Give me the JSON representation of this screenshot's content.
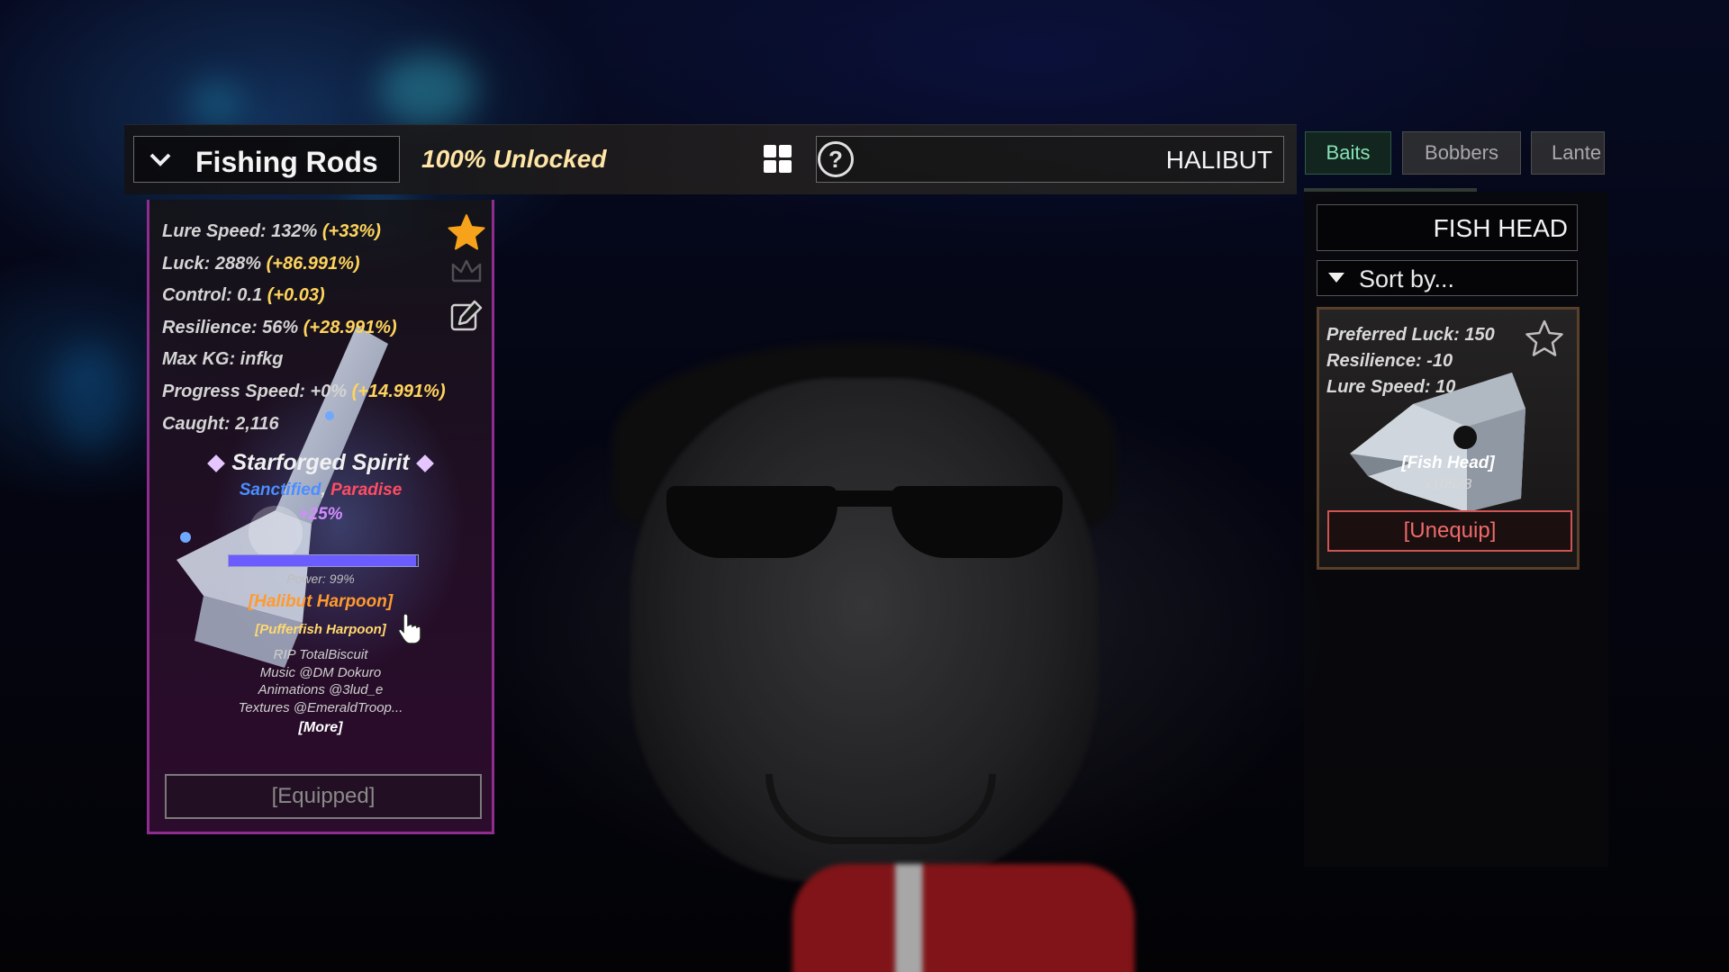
{
  "header": {
    "category": "Fishing Rods",
    "unlocked": "100% Unlocked",
    "search_value": "HALIBUT"
  },
  "tabs": [
    {
      "label": "Baits",
      "active": true
    },
    {
      "label": "Bobbers",
      "active": false
    },
    {
      "label": "Lante",
      "active": false
    }
  ],
  "rod": {
    "stats": [
      {
        "label": "Lure Speed: 132%",
        "bonus": "(+33%)"
      },
      {
        "label": "Luck: 288%",
        "bonus": "(+86.991%)"
      },
      {
        "label": "Control: 0.1",
        "bonus": "(+0.03)"
      },
      {
        "label": "Resilience: 56%",
        "bonus": "(+28.991%)"
      },
      {
        "label": "Max KG: infkg",
        "bonus": ""
      },
      {
        "label": "Progress Speed: +0%",
        "bonus": "(+14.991%)"
      },
      {
        "label": "Caught: 2,116",
        "bonus": ""
      }
    ],
    "enchant": "Starforged Spirit",
    "mutation_a": "Sanctified",
    "mutation_sep": ",",
    "mutation_b": "Paradise",
    "boost": "+25%",
    "power_label": "Power: 99%",
    "power_value": 0.99,
    "name": "[Halibut Harpoon]",
    "alt_name": "[Pufferfish Harpoon]",
    "credits": [
      "RIP TotalBiscuit",
      "Music @DM Dokuro",
      "Animations @3lud_e",
      "Textures @EmeraldTroop..."
    ],
    "more_label": "[More]",
    "equip_label": "[Equipped]"
  },
  "bait_panel": {
    "search_value": "FISH HEAD",
    "sort_label": "Sort by...",
    "card": {
      "stats": [
        "Preferred Luck: 150",
        "Resilience: -10",
        "Lure Speed: 10"
      ],
      "name": "[Fish Head]",
      "quantity": "x10528",
      "unequip_label": "[Unequip]"
    }
  },
  "colors": {
    "rod_border": "#8e2d8f",
    "bonus": "#ffd45c",
    "active_tab": "#86e1b4",
    "unequip": "#ef6b6b",
    "rod_name": "#ff9a2e"
  },
  "icons": [
    "chevron-down-icon",
    "grid-icon",
    "help-icon",
    "star-icon",
    "crown-icon",
    "edit-icon",
    "sort-arrow-icon",
    "pointer-cursor-icon"
  ]
}
